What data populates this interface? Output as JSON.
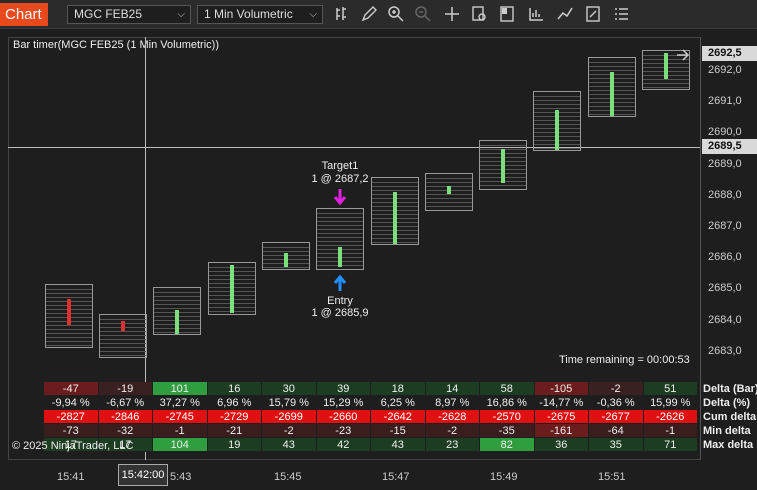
{
  "toolbar": {
    "tab_label": "Chart",
    "instrument": "MGC FEB25",
    "interval": "1 Min Volumetric"
  },
  "chart": {
    "title": "Bar timer(MGC FEB25 (1 Min Volumetric))",
    "time_remaining": "Time remaining = 00:00:53",
    "copyright": "© 2025 NinjaTrader, LLC",
    "target_label": "Target1",
    "target_order": "1 @ 2687,2",
    "entry_label": "Entry",
    "entry_order": "1 @ 2685,9",
    "last_price": "2692,5",
    "crosshair_price": "2689,5",
    "crosshair_time": "15:42:00"
  },
  "price_ticks": [
    "2692,0",
    "2691,0",
    "2690,0",
    "2689,0",
    "2688,0",
    "2687,0",
    "2686,0",
    "2685,0",
    "2684,0",
    "2683,0"
  ],
  "time_ticks": [
    "15:41",
    "5:43",
    "15:45",
    "15:47",
    "15:49",
    "15:51"
  ],
  "table": {
    "row_labels": [
      "Delta (Bar)",
      "Delta (%)",
      "Cum delta",
      "Min delta",
      "Max delta"
    ],
    "columns": [
      {
        "delta": "-47",
        "pct": "-9,94 %",
        "cum": "-2827",
        "min": "-73",
        "max": "17"
      },
      {
        "delta": "-19",
        "pct": "-6,67 %",
        "cum": "-2846",
        "min": "-32",
        "max": "17"
      },
      {
        "delta": "101",
        "pct": "37,27 %",
        "cum": "-2745",
        "min": "-1",
        "max": "104"
      },
      {
        "delta": "16",
        "pct": "6,96 %",
        "cum": "-2729",
        "min": "-21",
        "max": "19"
      },
      {
        "delta": "30",
        "pct": "15,79 %",
        "cum": "-2699",
        "min": "-2",
        "max": "43"
      },
      {
        "delta": "39",
        "pct": "15,29 %",
        "cum": "-2660",
        "min": "-23",
        "max": "42"
      },
      {
        "delta": "18",
        "pct": "6,25 %",
        "cum": "-2642",
        "min": "-15",
        "max": "43"
      },
      {
        "delta": "14",
        "pct": "8,97 %",
        "cum": "-2628",
        "min": "-2",
        "max": "23"
      },
      {
        "delta": "58",
        "pct": "16,86 %",
        "cum": "-2570",
        "min": "-35",
        "max": "82"
      },
      {
        "delta": "-105",
        "pct": "-14,77 %",
        "cum": "-2675",
        "min": "-161",
        "max": "36"
      },
      {
        "delta": "-2",
        "pct": "-0,36 %",
        "cum": "-2677",
        "min": "-64",
        "max": "35"
      },
      {
        "delta": "51",
        "pct": "15,99 %",
        "cum": "-2626",
        "min": "-1",
        "max": "71"
      }
    ]
  },
  "colors": {
    "tab": "#e8491d",
    "bull": "#2e7d32",
    "bear": "#6b1d1d",
    "cum_neg": "#e01010",
    "target": "#e020e0",
    "entry": "#2090ff"
  }
}
